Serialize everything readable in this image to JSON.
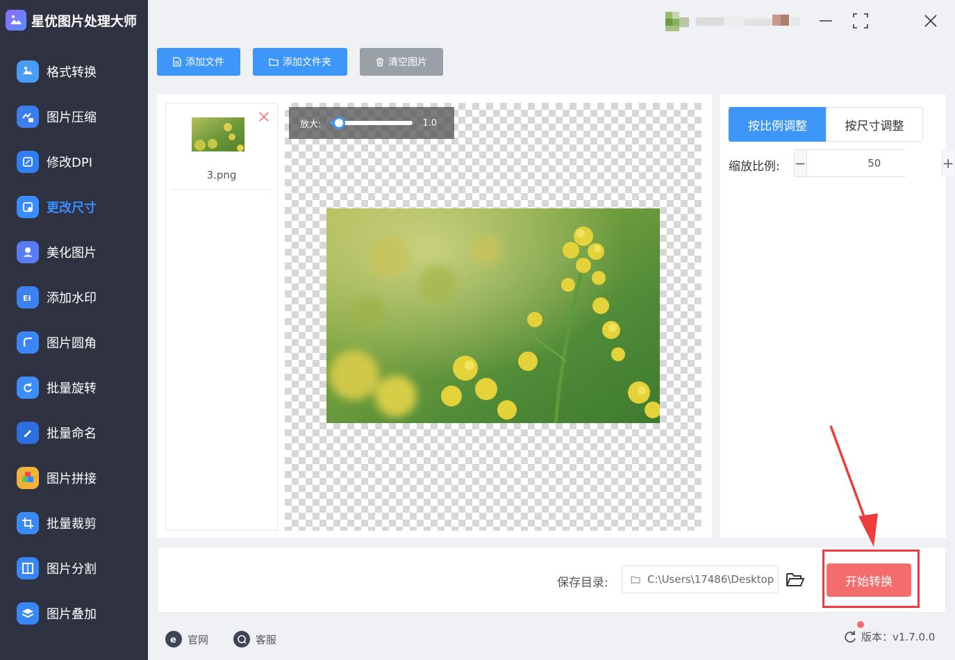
{
  "app": {
    "title": "星优图片处理大师"
  },
  "sidebar": {
    "items": [
      {
        "label": "格式转换",
        "icon": "format-convert-icon",
        "color": "#4a9cf5"
      },
      {
        "label": "图片压缩",
        "icon": "compress-icon",
        "color": "#3c7ef0"
      },
      {
        "label": "修改DPI",
        "icon": "dpi-icon",
        "color": "#2f7ff2"
      },
      {
        "label": "更改尺寸",
        "icon": "resize-icon",
        "color": "#3a8dff",
        "active": true
      },
      {
        "label": "美化图片",
        "icon": "beautify-icon",
        "color": "#5a7cf2"
      },
      {
        "label": "添加水印",
        "icon": "watermark-icon",
        "color": "#3b82f0"
      },
      {
        "label": "图片圆角",
        "icon": "round-corner-icon",
        "color": "#3a86f4"
      },
      {
        "label": "批量旋转",
        "icon": "rotate-icon",
        "color": "#3c8ef6"
      },
      {
        "label": "批量命名",
        "icon": "rename-icon",
        "color": "#2e6fdf"
      },
      {
        "label": "图片拼接",
        "icon": "puzzle-icon",
        "color": "#f0b33a"
      },
      {
        "label": "批量裁剪",
        "icon": "crop-icon",
        "color": "#3a8af5"
      },
      {
        "label": "图片分割",
        "icon": "split-icon",
        "color": "#3a86f4"
      },
      {
        "label": "图片叠加",
        "icon": "layers-icon",
        "color": "#3a86f4"
      }
    ]
  },
  "toolbar": {
    "add_file": "添加文件",
    "add_folder": "添加文件夹",
    "clear_images": "清空图片"
  },
  "file_list": [
    {
      "name": "3.png"
    }
  ],
  "preview": {
    "zoom_label": "放大:",
    "zoom_value": "1.0",
    "zoom_fraction": 0.1
  },
  "settings": {
    "tab_ratio": "按比例调整",
    "tab_size": "按尺寸调整",
    "scale_label": "缩放比例:",
    "scale_value": "50",
    "minus": "−",
    "plus": "+"
  },
  "output": {
    "save_label": "保存目录:",
    "save_path": "C:\\Users\\17486\\Desktop",
    "start_button": "开始转换"
  },
  "status": {
    "website": "官网",
    "support": "客服",
    "version": "版本：v1.7.0.0"
  },
  "colors": {
    "accent": "#3d96f8",
    "start": "#f56c6c",
    "sidebar": "#2e3241",
    "highlight": "#ee3c3c"
  }
}
